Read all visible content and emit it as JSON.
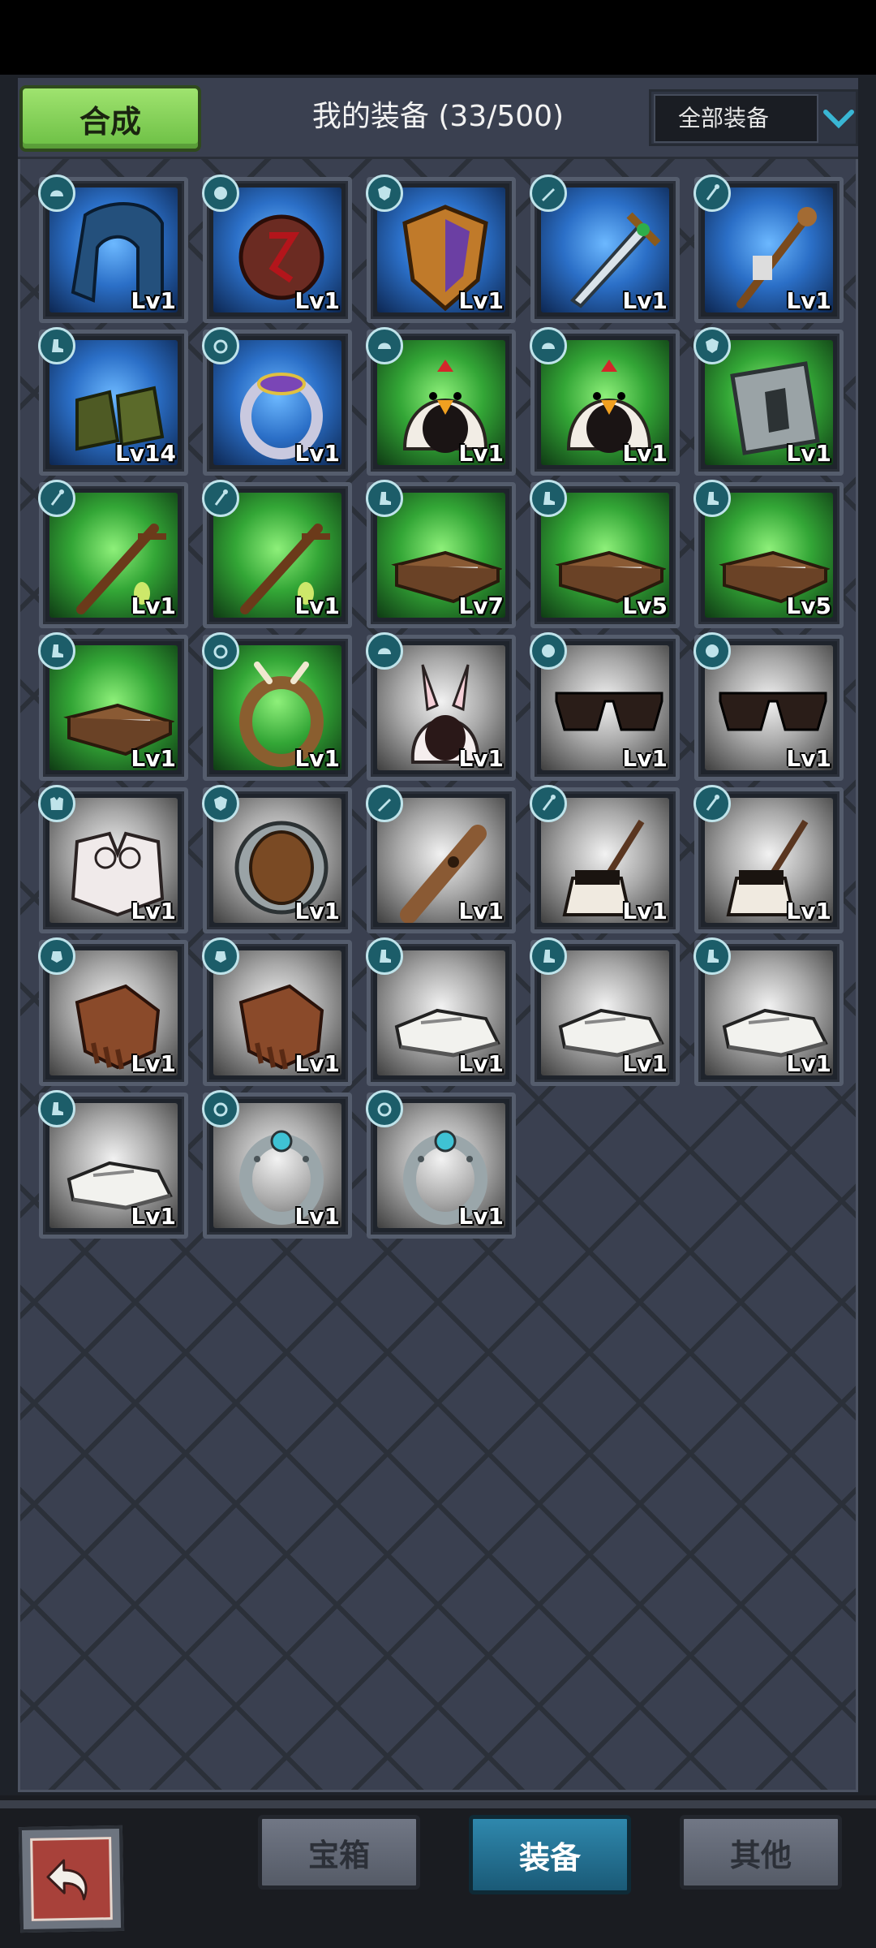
{
  "header": {
    "merge_label": "合成",
    "title": "我的装备 (33/500)",
    "filter_value": "全部装备"
  },
  "items": [
    {
      "name": "hood",
      "level": "Lv1",
      "rarity": "blue",
      "slot": "helmet"
    },
    {
      "name": "amulet",
      "level": "Lv1",
      "rarity": "blue",
      "slot": "necklace"
    },
    {
      "name": "shield",
      "level": "Lv1",
      "rarity": "blue",
      "slot": "offhand"
    },
    {
      "name": "sword",
      "level": "Lv1",
      "rarity": "blue",
      "slot": "weapon"
    },
    {
      "name": "staff",
      "level": "Lv1",
      "rarity": "blue",
      "slot": "staff"
    },
    {
      "name": "boots",
      "level": "Lv14",
      "rarity": "blue",
      "slot": "boots"
    },
    {
      "name": "ring",
      "level": "Lv1",
      "rarity": "blue",
      "slot": "ring"
    },
    {
      "name": "chicken-hat",
      "level": "Lv1",
      "rarity": "green",
      "slot": "helmet"
    },
    {
      "name": "chicken-hat",
      "level": "Lv1",
      "rarity": "green",
      "slot": "helmet"
    },
    {
      "name": "stone-shield",
      "level": "Lv1",
      "rarity": "green",
      "slot": "offhand"
    },
    {
      "name": "wood-staff",
      "level": "Lv1",
      "rarity": "green",
      "slot": "staff"
    },
    {
      "name": "wood-staff",
      "level": "Lv1",
      "rarity": "green",
      "slot": "staff"
    },
    {
      "name": "sandals",
      "level": "Lv7",
      "rarity": "green",
      "slot": "boots"
    },
    {
      "name": "sandals",
      "level": "Lv5",
      "rarity": "green",
      "slot": "boots"
    },
    {
      "name": "sandals",
      "level": "Lv5",
      "rarity": "green",
      "slot": "boots"
    },
    {
      "name": "sandals",
      "level": "Lv1",
      "rarity": "green",
      "slot": "boots"
    },
    {
      "name": "horn-ring",
      "level": "Lv1",
      "rarity": "green",
      "slot": "ring"
    },
    {
      "name": "bunny-hood",
      "level": "Lv1",
      "rarity": "gray",
      "slot": "helmet"
    },
    {
      "name": "sunglasses",
      "level": "Lv1",
      "rarity": "gray",
      "slot": "necklace"
    },
    {
      "name": "sunglasses",
      "level": "Lv1",
      "rarity": "gray",
      "slot": "necklace"
    },
    {
      "name": "fur-armor",
      "level": "Lv1",
      "rarity": "gray",
      "slot": "armor"
    },
    {
      "name": "round-shield",
      "level": "Lv1",
      "rarity": "gray",
      "slot": "offhand"
    },
    {
      "name": "wooden-sword",
      "level": "Lv1",
      "rarity": "gray",
      "slot": "weapon"
    },
    {
      "name": "broom",
      "level": "Lv1",
      "rarity": "gray",
      "slot": "staff"
    },
    {
      "name": "broom",
      "level": "Lv1",
      "rarity": "gray",
      "slot": "staff"
    },
    {
      "name": "gloves",
      "level": "Lv1",
      "rarity": "gray",
      "slot": "gloves"
    },
    {
      "name": "gloves",
      "level": "Lv1",
      "rarity": "gray",
      "slot": "gloves"
    },
    {
      "name": "shoes",
      "level": "Lv1",
      "rarity": "gray",
      "slot": "boots"
    },
    {
      "name": "shoes",
      "level": "Lv1",
      "rarity": "gray",
      "slot": "boots"
    },
    {
      "name": "shoes",
      "level": "Lv1",
      "rarity": "gray",
      "slot": "boots"
    },
    {
      "name": "shoes",
      "level": "Lv1",
      "rarity": "gray",
      "slot": "boots"
    },
    {
      "name": "metal-ring",
      "level": "Lv1",
      "rarity": "gray",
      "slot": "ring"
    },
    {
      "name": "metal-ring",
      "level": "Lv1",
      "rarity": "gray",
      "slot": "ring"
    }
  ],
  "tabs": [
    {
      "label": "宝箱"
    },
    {
      "label": "装备",
      "active": true
    },
    {
      "label": "其他"
    }
  ],
  "colors": {
    "merge_green": "#7ccf4f",
    "active_tab": "#2a7ea3",
    "badge_teal": "#1c5d69"
  }
}
